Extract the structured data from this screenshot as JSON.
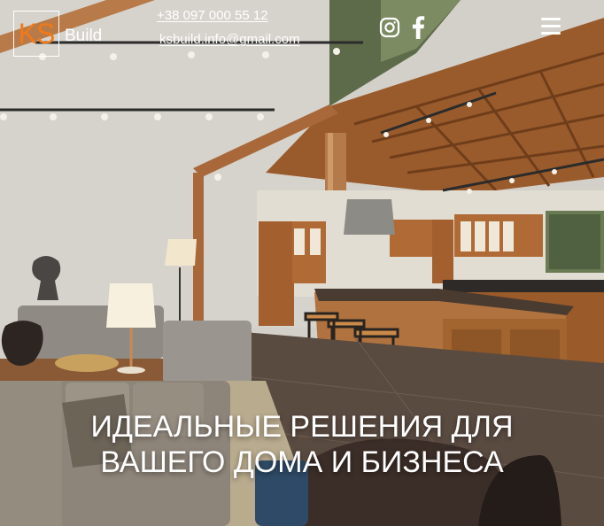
{
  "brand": {
    "mark": "KS",
    "name": "Build"
  },
  "contacts": {
    "phone": "+38 097 000 55 12",
    "email": "ksbuild.info@gmail.com"
  },
  "social": {
    "instagram_icon": "instagram-icon",
    "facebook_icon": "facebook-icon"
  },
  "menu": {
    "icon": "hamburger-menu-icon"
  },
  "hero": {
    "line1": "Идеальные решения для",
    "line2": "вашего дома и бизнеса"
  },
  "colors": {
    "brand_orange": "#f07a1a",
    "text": "#ffffff"
  }
}
